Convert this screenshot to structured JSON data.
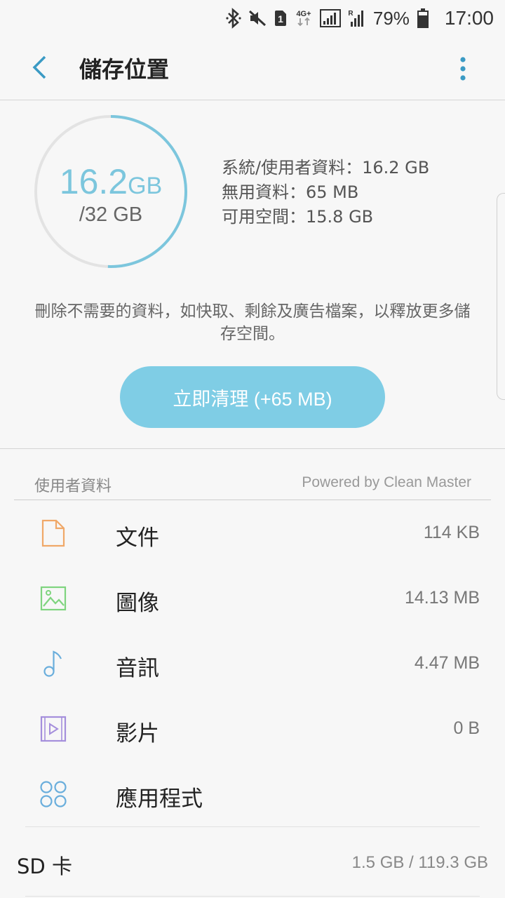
{
  "status_bar": {
    "battery": "79%",
    "time": "17:00",
    "icons": [
      "bluetooth-icon",
      "mute-icon",
      "sim1-icon",
      "4g-plus-icon",
      "signal-icon",
      "roaming-signal-icon",
      "battery-icon"
    ]
  },
  "header": {
    "back_icon": "chevron-left-icon",
    "title": "儲存位置",
    "more_icon": "more-vertical-icon"
  },
  "summary": {
    "used_number": "16.2",
    "used_unit": "GB",
    "total": "/32 GB",
    "used_fraction": 0.506,
    "stats": [
      "系統/使用者資料：16.2 GB",
      "無用資料：65 MB",
      "可用空間：15.8 GB"
    ],
    "description": "刪除不需要的資料，如快取、剩餘及廣告檔案，以釋放更多儲存空間。",
    "clean_button": "立即清理 (+65 MB)"
  },
  "section": {
    "title": "使用者資料",
    "powered_by": "Powered by Clean Master"
  },
  "items": [
    {
      "label": "文件",
      "value": "114 KB",
      "icon": "document-icon",
      "color": "#f0a868"
    },
    {
      "label": "圖像",
      "value": "14.13 MB",
      "icon": "image-icon",
      "color": "#7fd47f"
    },
    {
      "label": "音訊",
      "value": "4.47 MB",
      "icon": "music-note-icon",
      "color": "#6aaedc"
    },
    {
      "label": "影片",
      "value": "0 B",
      "icon": "video-icon",
      "color": "#a58fdc"
    },
    {
      "label": "應用程式",
      "value": "",
      "icon": "apps-icon",
      "color": "#6aaedc"
    }
  ],
  "sd_card": {
    "label": "SD 卡",
    "value": "1.5 GB / 119.3 GB"
  },
  "colors": {
    "accent": "#7cc6dd",
    "button": "#7fcde5",
    "ring_track": "#e3e3e3"
  }
}
